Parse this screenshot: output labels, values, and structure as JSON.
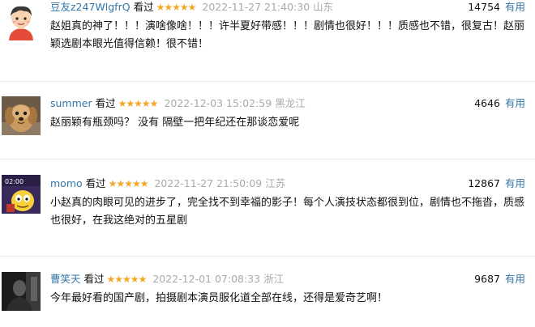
{
  "comments": [
    {
      "username": "豆友z247WlgfrQ",
      "status": "看过",
      "stars": "★★★★★",
      "time": "2022-11-27 21:40:30",
      "location": "山东",
      "votes": "14754",
      "useful_label": "有用",
      "content": "赵姐真的神了！！！演啥像啥！！！许半夏好带感！！！剧情也很好！！！质感也不错，很复古！赵丽颖选剧本眼光值得信赖！很不错！",
      "avatar_icon": "cartoon-boy-avatar"
    },
    {
      "username": "summer",
      "status": "看过",
      "stars": "★★★★★",
      "time": "2022-12-03 15:02:59",
      "location": "黑龙江",
      "votes": "4646",
      "useful_label": "有用",
      "content": "赵丽颖有瓶颈吗？ 没有 隔壁一把年纪还在那谈恋爱呢",
      "avatar_icon": "puppy-photo-avatar"
    },
    {
      "username": "momo",
      "status": "看过",
      "stars": "★★★★★",
      "time": "2022-11-27 21:50:09",
      "location": "江苏",
      "votes": "12867",
      "useful_label": "有用",
      "content": "小赵真的肉眼可见的进步了，完全找不到幸福的影子！每个人演技状态都很到位，剧情也不拖沓，质感也很好，在我这绝对的五星剧",
      "avatar_icon": "cartoon-tv-avatar",
      "avatar_text": "02:00"
    },
    {
      "username": "曹笑天",
      "status": "看过",
      "stars": "★★★★★",
      "time": "2022-12-01 07:08:33",
      "location": "浙江",
      "votes": "9687",
      "useful_label": "有用",
      "content": "今年最好看的国产剧，拍摄剧本演员服化道全部在线，还得是爱奇艺啊！",
      "avatar_icon": "dark-portrait-avatar"
    }
  ],
  "colors": {
    "username": "#3377aa",
    "stars": "#f5a623",
    "meta_grey": "#aaaaaa",
    "divider": "#e8e8e8"
  }
}
